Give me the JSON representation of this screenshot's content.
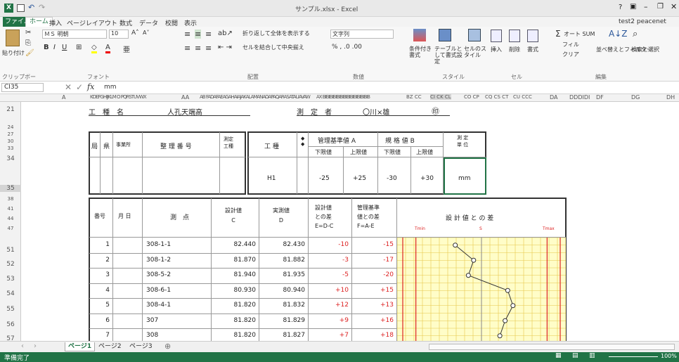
{
  "titlebar": {
    "title": "サンプル.xlsx - Excel",
    "help": "?",
    "user": "test2 peacenet"
  },
  "ribbon_tabs": [
    "ファイル",
    "ホーム",
    "挿入",
    "ページレイアウト",
    "数式",
    "データ",
    "校閲",
    "表示"
  ],
  "ribbon": {
    "paste": "貼り付け",
    "font_name": "ＭＳ 明朝",
    "font_size": "10",
    "wrap_text": "折り返して全体を表示する",
    "merge_center": "セルを結合して中央揃え",
    "number_format": "文字列",
    "cond_format": "条件付き書式",
    "table_format": "テーブルとして書式設定",
    "cell_styles": "セルのスタイル",
    "insert": "挿入",
    "delete": "削除",
    "format": "書式",
    "autosum": "オート SUM",
    "fill": "フィル",
    "clear": "クリア",
    "sort_filter": "並べ替えとフィルター",
    "find_select": "検索と選択",
    "groups": [
      "クリップボード",
      "フォント",
      "配置",
      "数値",
      "スタイル",
      "セル",
      "編集"
    ]
  },
  "formula_bar": {
    "name_box": "CI35",
    "fx": "fx",
    "value": "mm"
  },
  "col_headers": [
    "A",
    "KDEFGHIJKLM O PQRSTUVWX",
    "AA",
    "AB FADAFAEAGAHAIAJAKALAMANAOAPAQARASATAUAVAW",
    "AX BIBIBIBIBIBIBIBIBIBIBIBIBIB",
    "BZ CC",
    "CI CK CL",
    "CO CP",
    "CQ CS CT",
    "CU CCC",
    "DA",
    "DDDIDI",
    "DF",
    "DG",
    "DH"
  ],
  "row_headers": [
    "21",
    "24",
    "27",
    "30",
    "33",
    "34",
    "35",
    "38",
    "41",
    "44",
    "47",
    "51",
    "52",
    "53",
    "54",
    "55",
    "56",
    "57"
  ],
  "header_row": {
    "koshu_label": "工　種　名",
    "koshu_value": "人孔天端高",
    "sokutei_label": "測　定　者",
    "sokutei_value": "〇川×雄",
    "circle": "㊞"
  },
  "info_table": {
    "h_kyoku": "局",
    "h_ken": "県",
    "h_jimusho": "事業所",
    "h_seiri": "整 理 番 号",
    "h_shinsa": "測定\n工種",
    "h_koshu": "工 種",
    "h_kanri": "管理基準値 A",
    "h_kikaku": "規 格 値 B",
    "h_sokutei": "測 定\n単 位",
    "sub_lower": "下限値",
    "sub_upper": "上限値",
    "sub_lower2": "下限値",
    "sub_upper2": "上限値",
    "koshu_val": "H1",
    "a_lower": "-25",
    "a_upper": "+25",
    "b_lower": "-30",
    "b_upper": "+30",
    "unit": "mm"
  },
  "meas_table": {
    "headers": [
      "番号",
      "月 日",
      "測 点",
      "設計値\nC",
      "実測値\nD",
      "設計値\nとの差\nE=D-C",
      "管理基準\n値との差\nF=A-E",
      "設 計 値 と の 差"
    ],
    "chart_labels": {
      "left": "Tmin",
      "mid": "S",
      "right": "Tmax"
    },
    "rows": [
      {
        "no": "1",
        "point": "308-1-1",
        "c": "82.440",
        "d": "82.430",
        "e": "-10",
        "f": "-15"
      },
      {
        "no": "2",
        "point": "308-1-2",
        "c": "81.870",
        "d": "81.882",
        "e": "-3",
        "f": "-17"
      },
      {
        "no": "3",
        "point": "308-5-2",
        "c": "81.940",
        "d": "81.935",
        "e": "-5",
        "f": "-20"
      },
      {
        "no": "4",
        "point": "308-6-1",
        "c": "80.930",
        "d": "80.940",
        "e": "+10",
        "f": "+15"
      },
      {
        "no": "5",
        "point": "308-4-1",
        "c": "81.820",
        "d": "81.832",
        "e": "+12",
        "f": "+13"
      },
      {
        "no": "6",
        "point": "307",
        "c": "81.820",
        "d": "81.829",
        "e": "+9",
        "f": "+16"
      },
      {
        "no": "7",
        "point": "308",
        "c": "81.820",
        "d": "81.827",
        "e": "+7",
        "f": "+18"
      }
    ]
  },
  "chart_data": {
    "type": "line",
    "x": [
      1,
      2,
      3,
      4,
      5,
      6,
      7
    ],
    "series": [
      {
        "values": [
          -10,
          -3,
          -5,
          10,
          12,
          9,
          7
        ]
      }
    ],
    "ylim": [
      -30,
      30
    ],
    "title": "設 計 値 と の 差"
  },
  "sheet_tabs": [
    "ページ1",
    "ページ2",
    "ページ3"
  ],
  "status": {
    "ready": "準備完了",
    "zoom": "100%"
  },
  "colors": {
    "excel_green": "#217346",
    "red": "#dd2222",
    "yellow": "#fffdc8"
  }
}
